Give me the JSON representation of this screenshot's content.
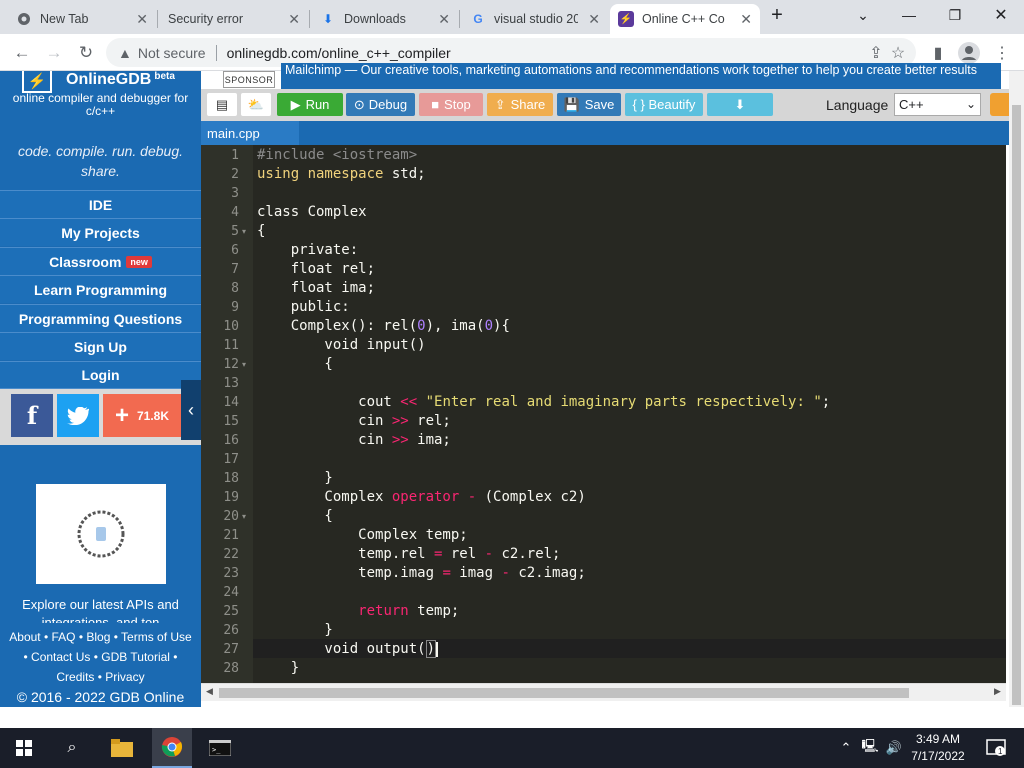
{
  "browser": {
    "tabs": [
      {
        "label": "New Tab",
        "icon": "chrome-icon"
      },
      {
        "label": "Security error",
        "icon": "none"
      },
      {
        "label": "Downloads",
        "icon": "download-icon"
      },
      {
        "label": "visual studio 20",
        "icon": "google-icon"
      },
      {
        "label": "Online C++ Co",
        "icon": "onlinegdb-icon"
      }
    ],
    "new_tab_symbol": "+",
    "omnibox": {
      "security_label": "Not secure",
      "url": "onlinegdb.com/online_c++_compiler"
    }
  },
  "sidebar": {
    "brand_name": "OnlineGDB",
    "brand_badge": "beta",
    "tagline": "online compiler and debugger for c/c++",
    "motto": "code. compile. run. debug. share.",
    "nav": [
      {
        "label": "IDE"
      },
      {
        "label": "My Projects"
      },
      {
        "label": "Classroom",
        "badge": "new"
      },
      {
        "label": "Learn Programming"
      },
      {
        "label": "Programming Questions"
      },
      {
        "label": "Sign Up"
      },
      {
        "label": "Login"
      }
    ],
    "share_count": "71.8K",
    "ad_text": "Explore our latest APIs and integrations, and ton",
    "footer_line1": "About • FAQ • Blog • Terms of Use",
    "footer_line2": "• Contact Us • GDB Tutorial •",
    "footer_line3": "Credits • Privacy",
    "copyright": "© 2016 - 2022 GDB Online"
  },
  "sponsor": {
    "label": "SPONSOR",
    "text": "Mailchimp — Our creative tools, marketing automations and recommendations work together to help you create better results"
  },
  "toolbar": {
    "run": "Run",
    "debug": "Debug",
    "stop": "Stop",
    "share": "Share",
    "save": "Save",
    "beautify": "{ } Beautify",
    "language_label": "Language",
    "language_value": "C++"
  },
  "editor": {
    "file_tab": "main.cpp",
    "line_numbers": [
      "1",
      "2",
      "3",
      "4",
      "5",
      "6",
      "7",
      "8",
      "9",
      "10",
      "11",
      "12",
      "13",
      "14",
      "15",
      "16",
      "17",
      "18",
      "19",
      "20",
      "21",
      "22",
      "23",
      "24",
      "25",
      "26",
      "27",
      "28"
    ]
  },
  "taskbar": {
    "time": "3:49 AM",
    "date": "7/17/2022",
    "notification_count": "1"
  },
  "colors": {
    "brand_blue": "#1b6ab2",
    "run_green": "#3aaa35",
    "debug_blue": "#337ab7",
    "stop_red": "#d9534f",
    "share_orange": "#f0ad4e",
    "editor_bg": "#272822"
  }
}
